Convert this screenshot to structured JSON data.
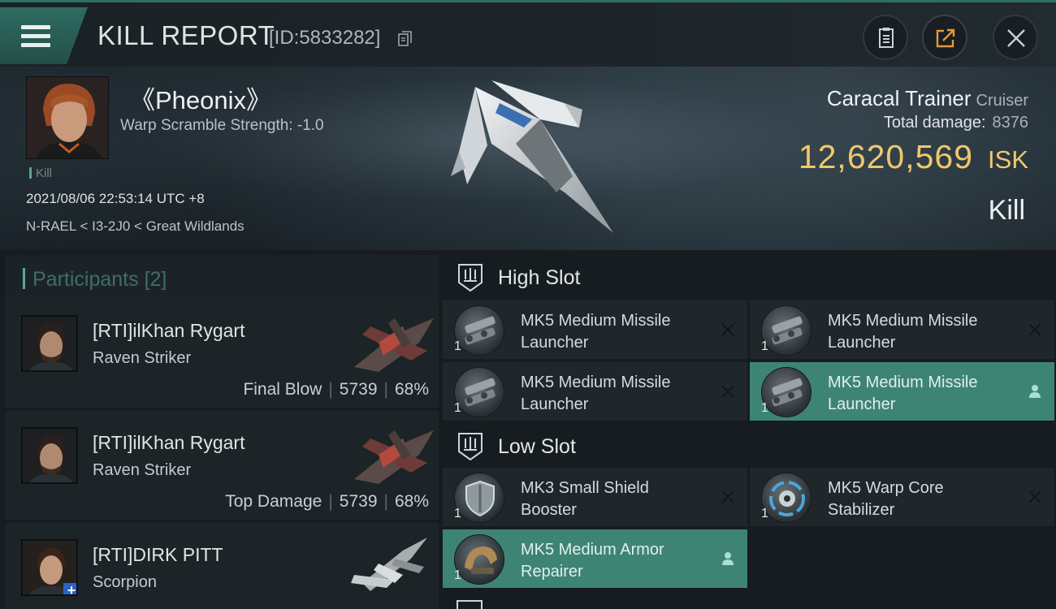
{
  "header": {
    "title": "KILL REPORT",
    "report_id": "[ID:5833282]"
  },
  "victim": {
    "name": "《Pheonix》",
    "warp_scramble": "Warp Scramble Strength: -1.0",
    "tag": "Kill",
    "datetime": "2021/08/06 22:53:14 UTC +8",
    "location": "N-RAEL < I3-2J0 < Great Wildlands",
    "ship": "Caracal Trainer",
    "ship_class": "Cruiser",
    "total_damage_label": "Total damage:",
    "total_damage": "8376",
    "isk_value": "12,620,569",
    "isk_unit": "ISK",
    "result": "Kill"
  },
  "participants": {
    "title": "Participants",
    "count": "[2]",
    "rows": [
      {
        "name": "[RTI]ilKhan Rygart",
        "ship": "Raven Striker",
        "role": "Final Blow",
        "damage": "5739",
        "percent": "68%"
      },
      {
        "name": "[RTI]ilKhan Rygart",
        "ship": "Raven Striker",
        "role": "Top Damage",
        "damage": "5739",
        "percent": "68%"
      },
      {
        "name": "[RTI]DIRK PITT",
        "ship": "Scorpion"
      }
    ]
  },
  "slots": {
    "high_title": "High Slot",
    "low_title": "Low Slot",
    "high": [
      {
        "name": "MK5 Medium Missile Launcher",
        "qty": "1",
        "state": "destroyed"
      },
      {
        "name": "MK5 Medium Missile Launcher",
        "qty": "1",
        "state": "destroyed"
      },
      {
        "name": "MK5 Medium Missile Launcher",
        "qty": "1",
        "state": "destroyed"
      },
      {
        "name": "MK5 Medium Missile Launcher",
        "qty": "1",
        "state": "dropped"
      }
    ],
    "low": [
      {
        "name": "MK3 Small Shield Booster",
        "qty": "1",
        "state": "destroyed"
      },
      {
        "name": "MK5 Warp Core Stabilizer",
        "qty": "1",
        "state": "destroyed"
      },
      {
        "name": "MK5 Medium Armor Repairer",
        "qty": "1",
        "state": "dropped"
      }
    ]
  },
  "colors": {
    "accent": "#3e8474",
    "isk": "#f0c86a",
    "panel": "#20272b"
  }
}
